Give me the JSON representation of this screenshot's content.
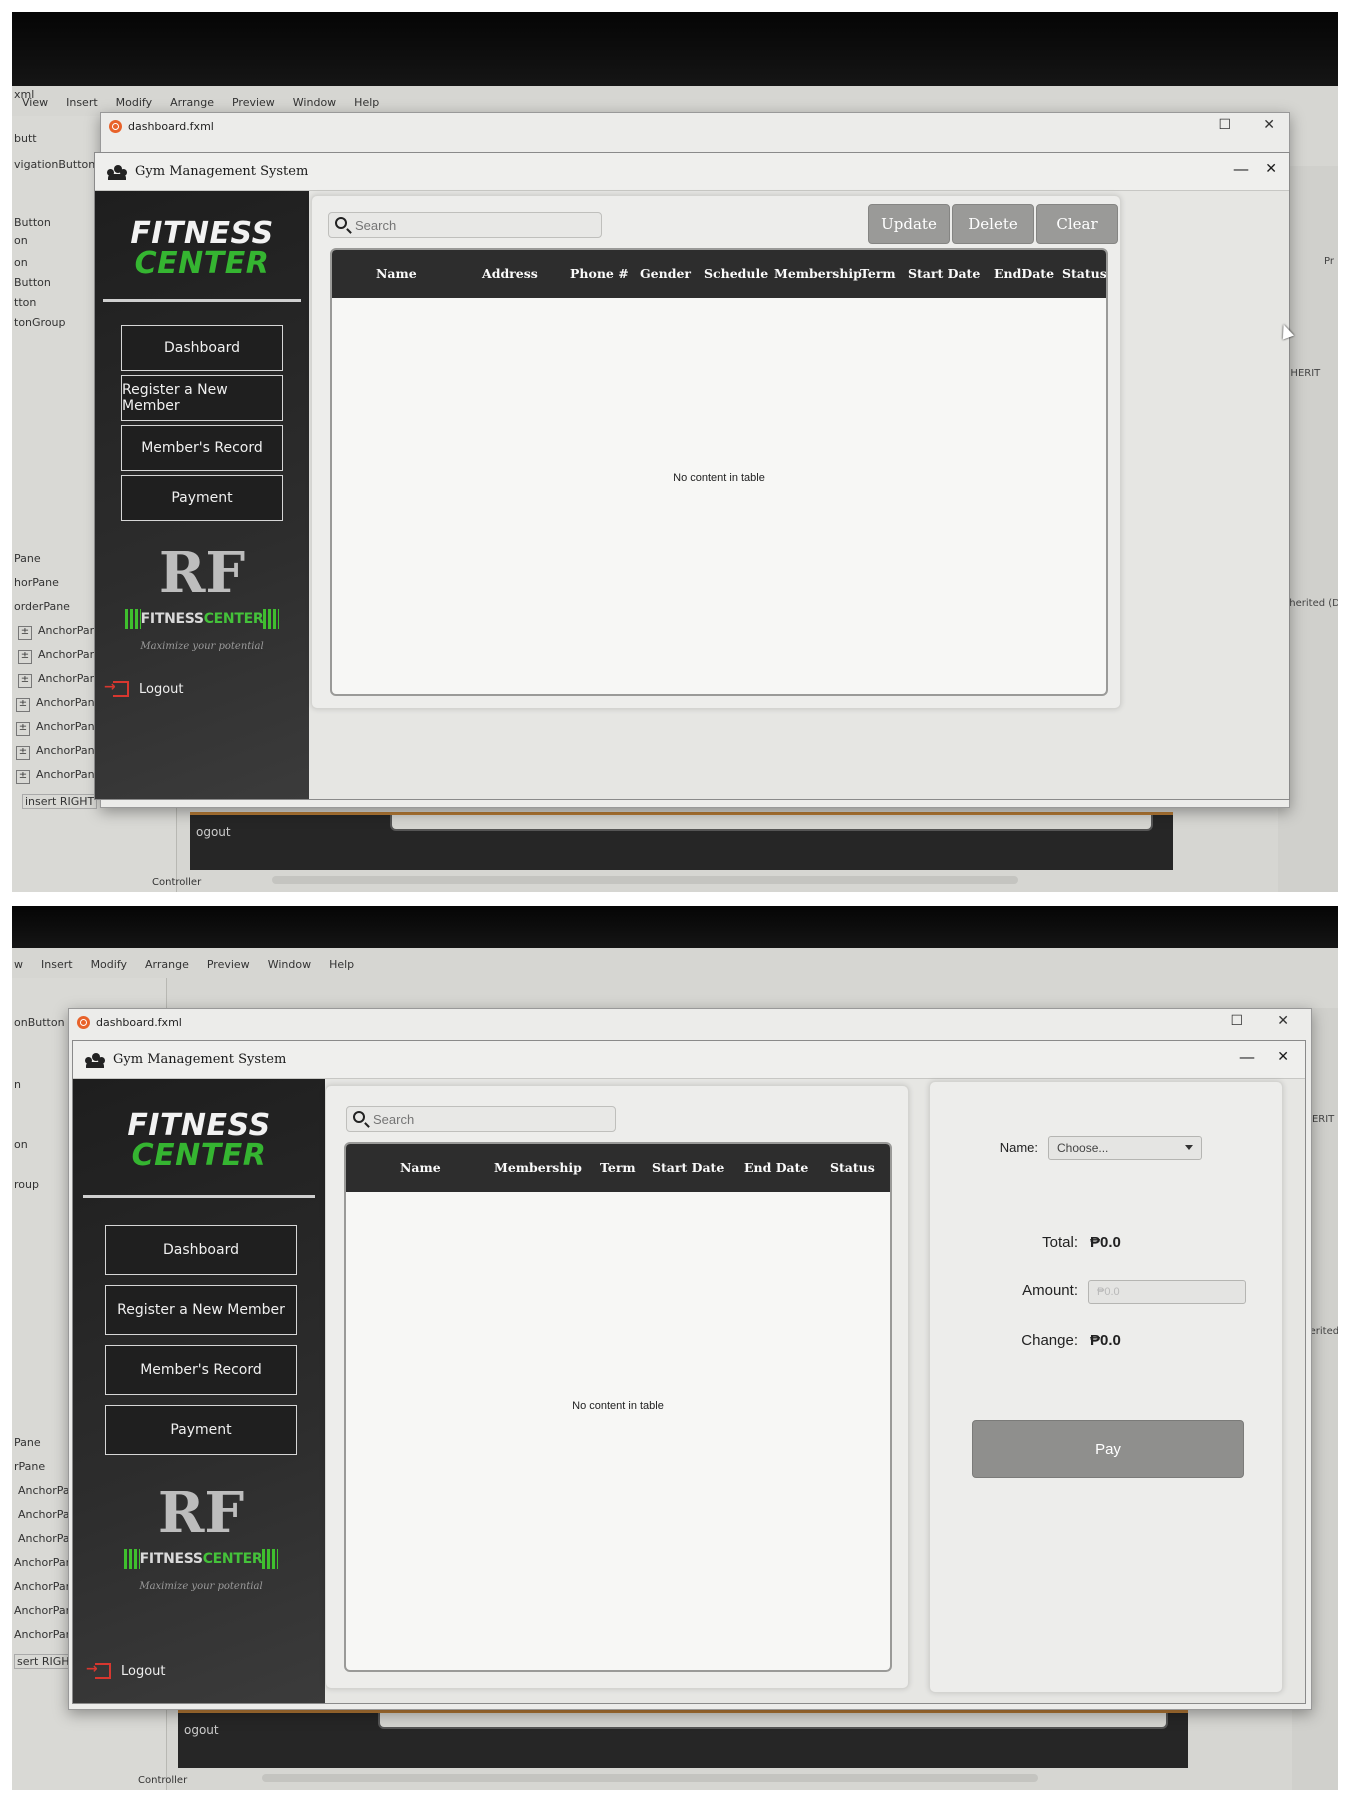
{
  "ide": {
    "menu": [
      "View",
      "Insert",
      "Modify",
      "Arrange",
      "Preview",
      "Window",
      "Help"
    ],
    "menu2": [
      "w",
      "Insert",
      "Modify",
      "Arrange",
      "Preview",
      "Window",
      "Help"
    ],
    "file_tab": "dashboard.fxml",
    "left_items_1": [
      "xml",
      "butt",
      "vigationButton",
      "Button",
      "on",
      "on",
      "Button",
      "tton",
      "tonGroup",
      "Pane",
      "horPane",
      "orderPane"
    ],
    "tree_items_1": [
      "AnchorPan",
      "AnchorPan",
      "AnchorPan",
      "AnchorPane",
      "AnchorPane",
      "AnchorPane",
      "AnchorPane"
    ],
    "insert_right_1": "insert RIGHT",
    "left_items_2": [
      "onButton",
      "n",
      "on",
      "roup",
      "Pane",
      "rPane"
    ],
    "tree_items_2": [
      "AnchorPan",
      "AnchorPan",
      "AnchorPan",
      "AnchorPane",
      "AnchorPane",
      "AnchorPane",
      "AnchorPane"
    ],
    "insert_right_2": "sert RIGHT",
    "controller": "Controller",
    "canvas_logout": "ogout",
    "right_items": [
      "Pr",
      "INHERIT",
      "Inherited (De"
    ],
    "right_items_2": [
      "INHERIT",
      "Inherited"
    ]
  },
  "app": {
    "title": "Gym Management System",
    "brand_line1": "FITNESS",
    "brand_line2": "CENTER",
    "nav": [
      "Dashboard",
      "Register a New Member",
      "Member's Record",
      "Payment"
    ],
    "logo_letters": "RF",
    "logo_text_white": "FITNESS",
    "logo_text_green": "CENTER",
    "logo_tagline": "Maximize your potential",
    "logout": "Logout",
    "window_controls": {
      "minimize": "—",
      "close": "✕",
      "maximize": "☐"
    }
  },
  "dashboard": {
    "search_placeholder": "Search",
    "buttons": {
      "update": "Update",
      "delete": "Delete",
      "clear": "Clear"
    },
    "columns": [
      "Name",
      "Address",
      "Phone #",
      "Gender",
      "Schedule",
      "Membership",
      "Term",
      "Start Date",
      "EndDate",
      "Status"
    ],
    "empty_message": "No content in table"
  },
  "payment": {
    "search_placeholder": "Search",
    "columns": [
      "Name",
      "Membership",
      "Term",
      "Start Date",
      "End Date",
      "Status"
    ],
    "empty_message": "No content in table",
    "name_label": "Name:",
    "name_choice": "Choose...",
    "total_label": "Total:",
    "total_value": "₱0.0",
    "amount_label": "Amount:",
    "amount_placeholder": "₱0.0",
    "change_label": "Change:",
    "change_value": "₱0.0",
    "pay_button": "Pay"
  }
}
